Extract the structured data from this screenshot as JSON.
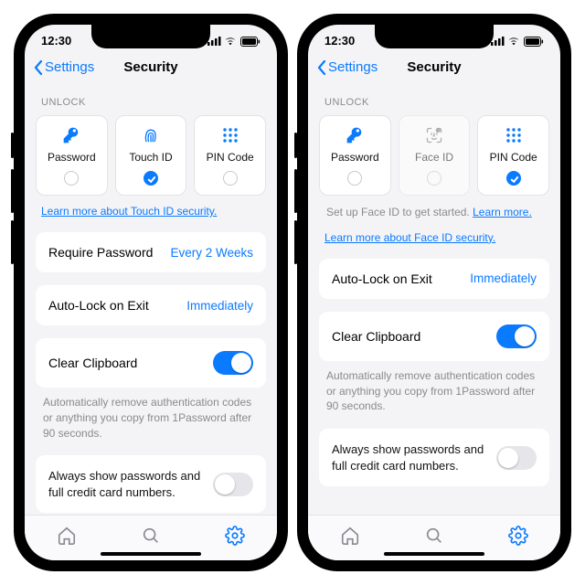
{
  "status": {
    "time": "12:30"
  },
  "nav": {
    "back": "Settings",
    "title": "Security"
  },
  "unlock": {
    "label": "UNLOCK",
    "options": {
      "password": "Password",
      "touchid": "Touch ID",
      "faceid": "Face ID",
      "pin": "PIN Code"
    },
    "link_touchid": "Learn more about Touch ID security.",
    "faceid_setup": "Set up Face ID to get started. ",
    "faceid_setup_link": "Learn more.",
    "link_faceid": "Learn more about Face ID security."
  },
  "rows": {
    "require_pw": {
      "label": "Require Password",
      "value": "Every 2 Weeks"
    },
    "autolock": {
      "label": "Auto-Lock on Exit",
      "value": "Immediately"
    },
    "clear_clip": {
      "label": "Clear Clipboard"
    },
    "clip_note": "Automatically remove authentication codes or anything you copy from 1Password after 90 seconds.",
    "reveal": "Always show passwords and full credit card numbers."
  }
}
